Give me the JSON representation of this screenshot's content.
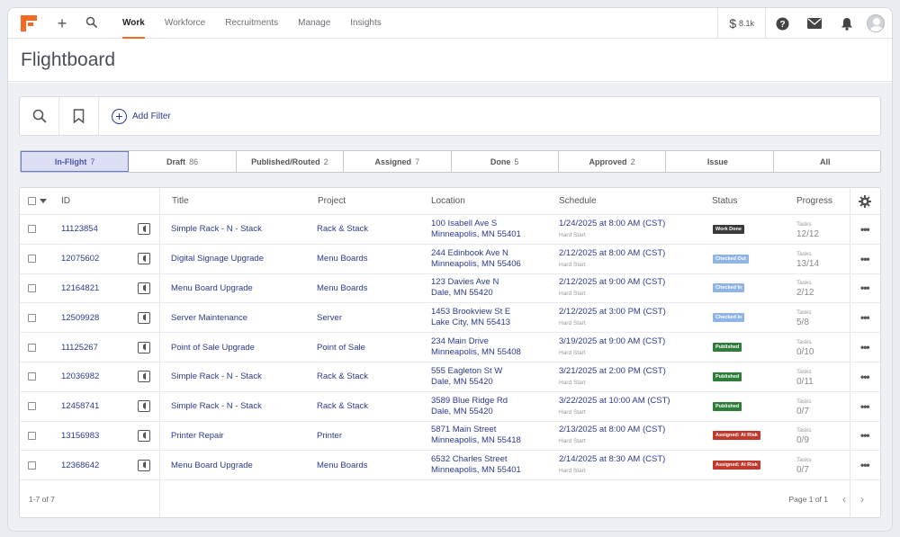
{
  "nav": {
    "items": [
      "Work",
      "Workforce",
      "Recruitments",
      "Manage",
      "Insights"
    ],
    "active": "Work"
  },
  "account": {
    "currency": "$",
    "balance": "8.1k"
  },
  "page": {
    "title": "Flightboard"
  },
  "filter": {
    "add_label": "Add Filter"
  },
  "tabs": [
    {
      "label": "In-Flight",
      "count": "7"
    },
    {
      "label": "Draft",
      "count": "86"
    },
    {
      "label": "Published/Routed",
      "count": "2"
    },
    {
      "label": "Assigned",
      "count": "7"
    },
    {
      "label": "Done",
      "count": "5"
    },
    {
      "label": "Approved",
      "count": "2"
    },
    {
      "label": "Issue",
      "count": ""
    },
    {
      "label": "All",
      "count": ""
    }
  ],
  "table": {
    "headers": {
      "id": "ID",
      "title": "Title",
      "project": "Project",
      "location": "Location",
      "schedule": "Schedule",
      "status": "Status",
      "progress": "Progress"
    },
    "rows": [
      {
        "id": "11123854",
        "title": "Simple Rack - N - Stack",
        "project": "Rack & Stack",
        "addr1": "100 Isabell Ave S",
        "addr2": "Minneapolis, MN 55401",
        "schedule": "1/24/2025 at 8:00 AM (CST)",
        "sched_sub": "Hard Start",
        "status": "Work Done",
        "status_color": "#3a3a3a",
        "tasks_label": "Tasks",
        "progress": "12/12"
      },
      {
        "id": "12075602",
        "title": "Digital Signage Upgrade",
        "project": "Menu Boards",
        "addr1": "244 Edinbook Ave N",
        "addr2": "Minneapolis, MN 55406",
        "schedule": "2/12/2025 at 8:00 AM (CST)",
        "sched_sub": "Hard Start",
        "status": "Checked Out",
        "status_color": "#8fb4e8",
        "tasks_label": "Tasks",
        "progress": "13/14"
      },
      {
        "id": "12164821",
        "title": "Menu Board Upgrade",
        "project": "Menu Boards",
        "addr1": "123 Davies Ave N",
        "addr2": "Dale, MN 55420",
        "schedule": "2/12/2025 at 9:00 AM (CST)",
        "sched_sub": "Hard Start",
        "status": "Checked In",
        "status_color": "#8fb4e8",
        "tasks_label": "Tasks",
        "progress": "2/12"
      },
      {
        "id": "12509928",
        "title": "Server Maintenance",
        "project": "Server",
        "addr1": "1453 Brookview St E",
        "addr2": "Lake City, MN 55413",
        "schedule": "2/12/2025 at 3:00 PM (CST)",
        "sched_sub": "Hard Start",
        "status": "Checked In",
        "status_color": "#8fb4e8",
        "tasks_label": "Tasks",
        "progress": "5/8"
      },
      {
        "id": "11125267",
        "title": "Point of Sale Upgrade",
        "project": "Point of Sale",
        "addr1": "234 Main Drive",
        "addr2": "Minneapolis, MN 55408",
        "schedule": "3/19/2025 at 9:00 AM (CST)",
        "sched_sub": "Hard Start",
        "status": "Published",
        "status_color": "#2f7d3a",
        "tasks_label": "Tasks",
        "progress": "0/10"
      },
      {
        "id": "12036982",
        "title": "Simple Rack - N - Stack",
        "project": "Rack & Stack",
        "addr1": "555 Eagleton St W",
        "addr2": "Dale, MN 55420",
        "schedule": "3/21/2025 at 2:00 PM (CST)",
        "sched_sub": "Hard Start",
        "status": "Published",
        "status_color": "#2f7d3a",
        "tasks_label": "Tasks",
        "progress": "0/11"
      },
      {
        "id": "12458741",
        "title": "Simple Rack - N - Stack",
        "project": "Rack & Stack",
        "addr1": "3589 Blue Ridge Rd",
        "addr2": "Dale, MN 55420",
        "schedule": "3/22/2025 at 10:00 AM (CST)",
        "sched_sub": "Hard Start",
        "status": "Published",
        "status_color": "#2f7d3a",
        "tasks_label": "Tasks",
        "progress": "0/7"
      },
      {
        "id": "13156983",
        "title": "Printer Repair",
        "project": "Printer",
        "addr1": "5871 Main Street",
        "addr2": "Minneapolis, MN 55418",
        "schedule": "2/13/2025 at 8:00 AM (CST)",
        "sched_sub": "Hard Start",
        "status": "Assigned: At Risk",
        "status_color": "#c0392b",
        "tasks_label": "Tasks",
        "progress": "0/9"
      },
      {
        "id": "12368642",
        "title": "Menu Board Upgrade",
        "project": "Menu Boards",
        "addr1": "6532 Charles Street",
        "addr2": "Minneapolis, MN 55401",
        "schedule": "2/14/2025 at 8:30 AM (CST)",
        "sched_sub": "Hard Start",
        "status": "Assigned: At Risk",
        "status_color": "#c0392b",
        "tasks_label": "Tasks",
        "progress": "0/7"
      }
    ]
  },
  "footer": {
    "range": "1-7 of 7",
    "page": "Page 1 of 1"
  },
  "colors": {
    "accent": "#f46a25",
    "link": "#2b3a8f"
  }
}
